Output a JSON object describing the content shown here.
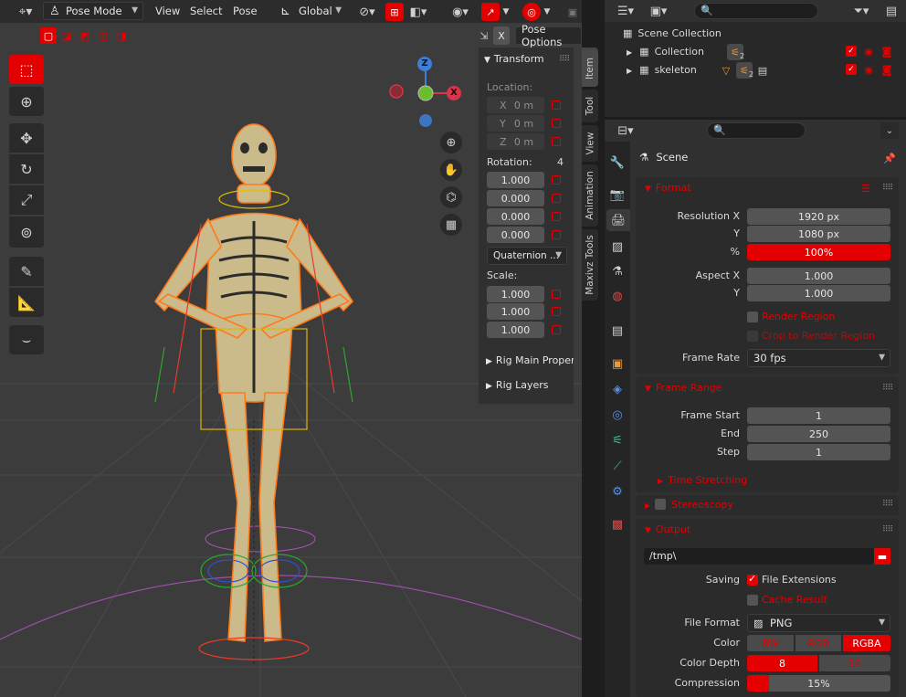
{
  "header": {
    "mode": "Pose Mode",
    "menus": [
      "View",
      "Select",
      "Pose"
    ],
    "orientation": "Global",
    "pose_options": "Pose Options",
    "x_toggle": "X"
  },
  "npanel": {
    "transform_title": "Transform",
    "location_label": "Location:",
    "loc_axes": [
      "X",
      "Y",
      "Z"
    ],
    "loc_values": [
      "0 m",
      "0 m",
      "0 m"
    ],
    "rotation_label": "Rotation:",
    "rotation_mode_value": "4",
    "rotation_values": [
      "1.000",
      "0.000",
      "0.000",
      "0.000"
    ],
    "rotation_mode": "Quaternion ...",
    "scale_label": "Scale:",
    "scale_values": [
      "1.000",
      "1.000",
      "1.000"
    ],
    "rig_main": "Rig Main Properti",
    "rig_layers": "Rig Layers",
    "tabs": [
      "Item",
      "Tool",
      "View",
      "Animation",
      "Maxivz Tools"
    ]
  },
  "gizmo": {
    "z": "Z",
    "x": "X"
  },
  "outliner": {
    "root": "Scene Collection",
    "items": [
      {
        "name": "Collection",
        "badge": "2"
      },
      {
        "name": "skeleton",
        "badge": "2"
      }
    ]
  },
  "properties": {
    "context": "Scene",
    "format": {
      "title": "Format",
      "res_x_label": "Resolution X",
      "res_x": "1920 px",
      "res_y_label": "Y",
      "res_y": "1080 px",
      "pct_label": "%",
      "pct": "100%",
      "aspect_x_label": "Aspect X",
      "aspect_x": "1.000",
      "aspect_y_label": "Y",
      "aspect_y": "1.000",
      "render_region": "Render Region",
      "crop_region": "Crop to Render Region",
      "frame_rate_label": "Frame Rate",
      "frame_rate": "30 fps"
    },
    "frame_range": {
      "title": "Frame Range",
      "start_label": "Frame Start",
      "start": "1",
      "end_label": "End",
      "end": "250",
      "step_label": "Step",
      "step": "1",
      "time_stretching": "Time Stretching"
    },
    "stereoscopy": "Stereoscopy",
    "output": {
      "title": "Output",
      "path": "/tmp\\",
      "saving_label": "Saving",
      "file_ext": "File Extensions",
      "cache_result": "Cache Result",
      "file_format_label": "File Format",
      "file_format": "PNG",
      "color_label": "Color",
      "color_opts": [
        "BW",
        "RGB",
        "RGBA"
      ],
      "depth_label": "Color Depth",
      "depth_opts": [
        "8",
        "16"
      ],
      "compression_label": "Compression",
      "compression": "15%",
      "compression_fraction": 0.15
    }
  },
  "colors": {
    "accent": "#e40000",
    "bg": "#1d1d1d",
    "panel": "#2b2b2b",
    "viewport": "#3d3d3d"
  }
}
